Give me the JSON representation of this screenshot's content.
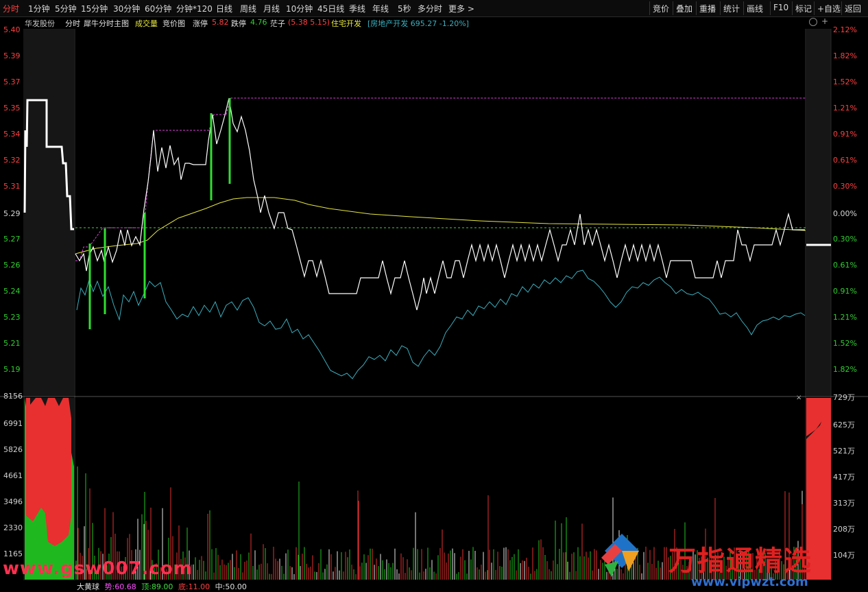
{
  "toolbar": {
    "tabs": [
      "分时",
      "1分钟",
      "5分钟",
      "15分钟",
      "30分钟",
      "60分钟",
      "分钟*120",
      "日线",
      "周线",
      "月线",
      "10分钟",
      "45日线",
      "季线",
      "年线",
      "5秒",
      "多分时",
      "更多 >"
    ],
    "active_tab": "分时",
    "right_buttons": [
      "竞价",
      "叠加",
      "重播",
      "统计",
      "画线",
      "F10",
      "标记",
      "+自选",
      "返回"
    ]
  },
  "legend": {
    "stock_name": "华发股份",
    "mode": "分时",
    "indicator": "犀牛分时主图",
    "volume_label": "成交量",
    "auction_label": "竞价图",
    "limit_up_label": "涨停",
    "limit_up_value": "5.82",
    "limit_down_label": "跌停",
    "limit_down_value": "4.76",
    "stub_label": "茫子",
    "stub_values": "(5.38 5.15)",
    "sector": "住宅开发",
    "index_info": "[房地产开发 695.27 -1.20%]"
  },
  "price_axis": [
    "5.40",
    "5.39",
    "5.37",
    "5.35",
    "5.34",
    "5.32",
    "5.31",
    "5.29",
    "5.27",
    "5.26",
    "5.24",
    "5.23",
    "5.21",
    "5.19"
  ],
  "pct_axis": [
    "2.12%",
    "1.82%",
    "1.52%",
    "1.21%",
    "0.91%",
    "0.61%",
    "0.30%",
    "0.00%",
    "0.30%",
    "0.61%",
    "0.91%",
    "1.21%",
    "1.52%",
    "1.82%"
  ],
  "volume_axis_left": [
    "8156",
    "6991",
    "5826",
    "4661",
    "3496",
    "2330",
    "1165"
  ],
  "volume_axis_right": [
    "729万",
    "625万",
    "521万",
    "417万",
    "313万",
    "208万",
    "104万"
  ],
  "status_bar": {
    "name": "大黄球",
    "trend_label": "势:",
    "trend_value": "60.68",
    "top_label": "顶:",
    "top_value": "89.00",
    "bottom_label": "底:",
    "bottom_value": "11.00",
    "mid_label": "中:",
    "mid_value": "50.00"
  },
  "watermarks": {
    "left_url": "www.gsw007.com",
    "brand": "万指通精选",
    "brand_url": "www.vipwzt.com"
  },
  "colors": {
    "up": "#ff3030",
    "down": "#22d822",
    "price_line": "#ffffff",
    "avg_line": "#e8e840",
    "index_line": "#3ab0c0",
    "axis_text": "#e04040"
  }
}
